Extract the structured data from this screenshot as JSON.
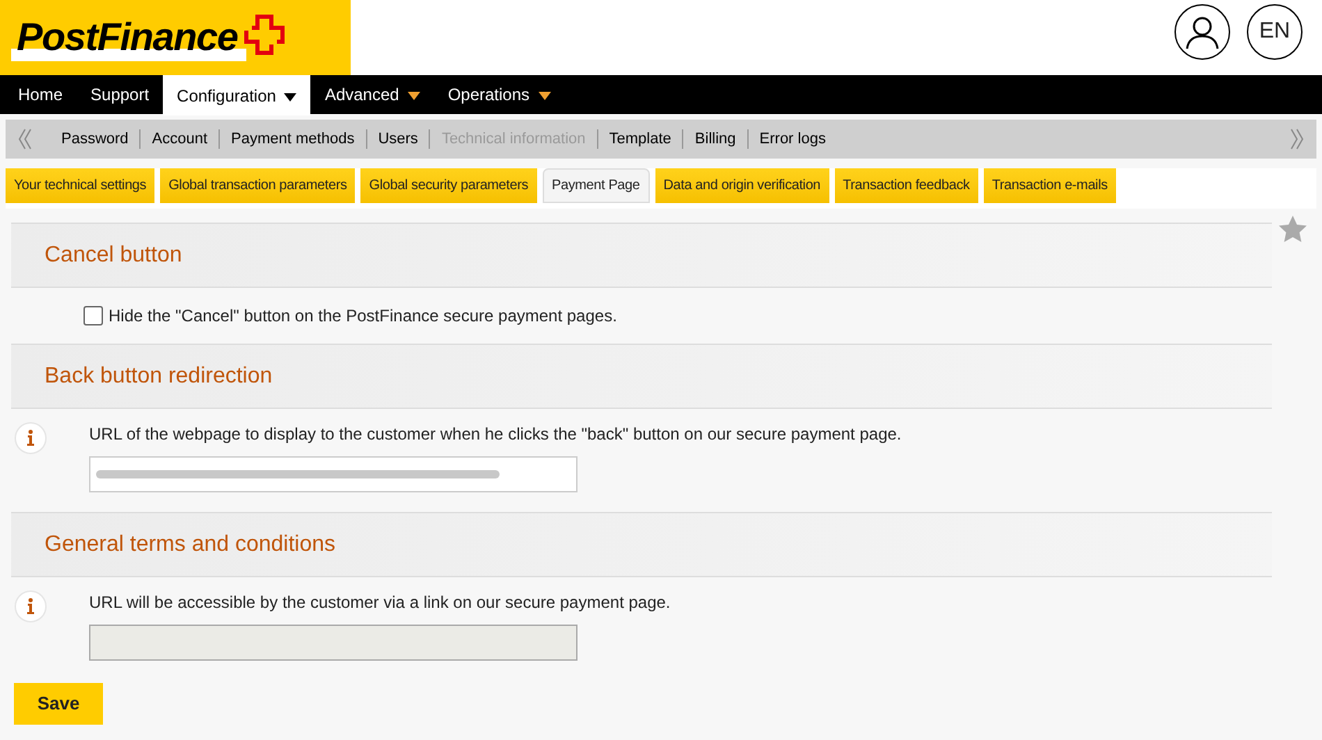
{
  "logo": {
    "text": "PostFinance"
  },
  "language": "EN",
  "nav": [
    {
      "label": "Home",
      "selected": false,
      "dropdown": false
    },
    {
      "label": "Support",
      "selected": false,
      "dropdown": false
    },
    {
      "label": "Configuration",
      "selected": true,
      "dropdown": true
    },
    {
      "label": "Advanced",
      "selected": false,
      "dropdown": true
    },
    {
      "label": "Operations",
      "selected": false,
      "dropdown": true
    }
  ],
  "subnav": [
    {
      "label": "Password",
      "disabled": false
    },
    {
      "label": "Account",
      "disabled": false
    },
    {
      "label": "Payment methods",
      "disabled": false
    },
    {
      "label": "Users",
      "disabled": false
    },
    {
      "label": "Technical information",
      "disabled": true
    },
    {
      "label": "Template",
      "disabled": false
    },
    {
      "label": "Billing",
      "disabled": false
    },
    {
      "label": "Error logs",
      "disabled": false
    }
  ],
  "tabs": [
    {
      "label": "Your technical settings",
      "selected": false
    },
    {
      "label": "Global transaction parameters",
      "selected": false
    },
    {
      "label": "Global security parameters",
      "selected": false
    },
    {
      "label": "Payment Page",
      "selected": true
    },
    {
      "label": "Data and origin verification",
      "selected": false
    },
    {
      "label": "Transaction feedback",
      "selected": false
    },
    {
      "label": "Transaction e-mails",
      "selected": false
    }
  ],
  "sections": [
    {
      "title": "Cancel button",
      "kind": "checkbox",
      "label": "Hide the \"Cancel\" button on the PostFinance secure payment pages.",
      "checked": false
    },
    {
      "title": "Back button redirection",
      "kind": "url",
      "label": "URL of the webpage to display to the customer when he clicks the \"back\" button on our secure payment page.",
      "blurred": true,
      "disabled": false
    },
    {
      "title": "General terms and conditions",
      "kind": "url",
      "label": "URL will be accessible by the customer via a link on our secure payment page.",
      "blurred": false,
      "disabled": true
    }
  ],
  "save_button": "Save"
}
